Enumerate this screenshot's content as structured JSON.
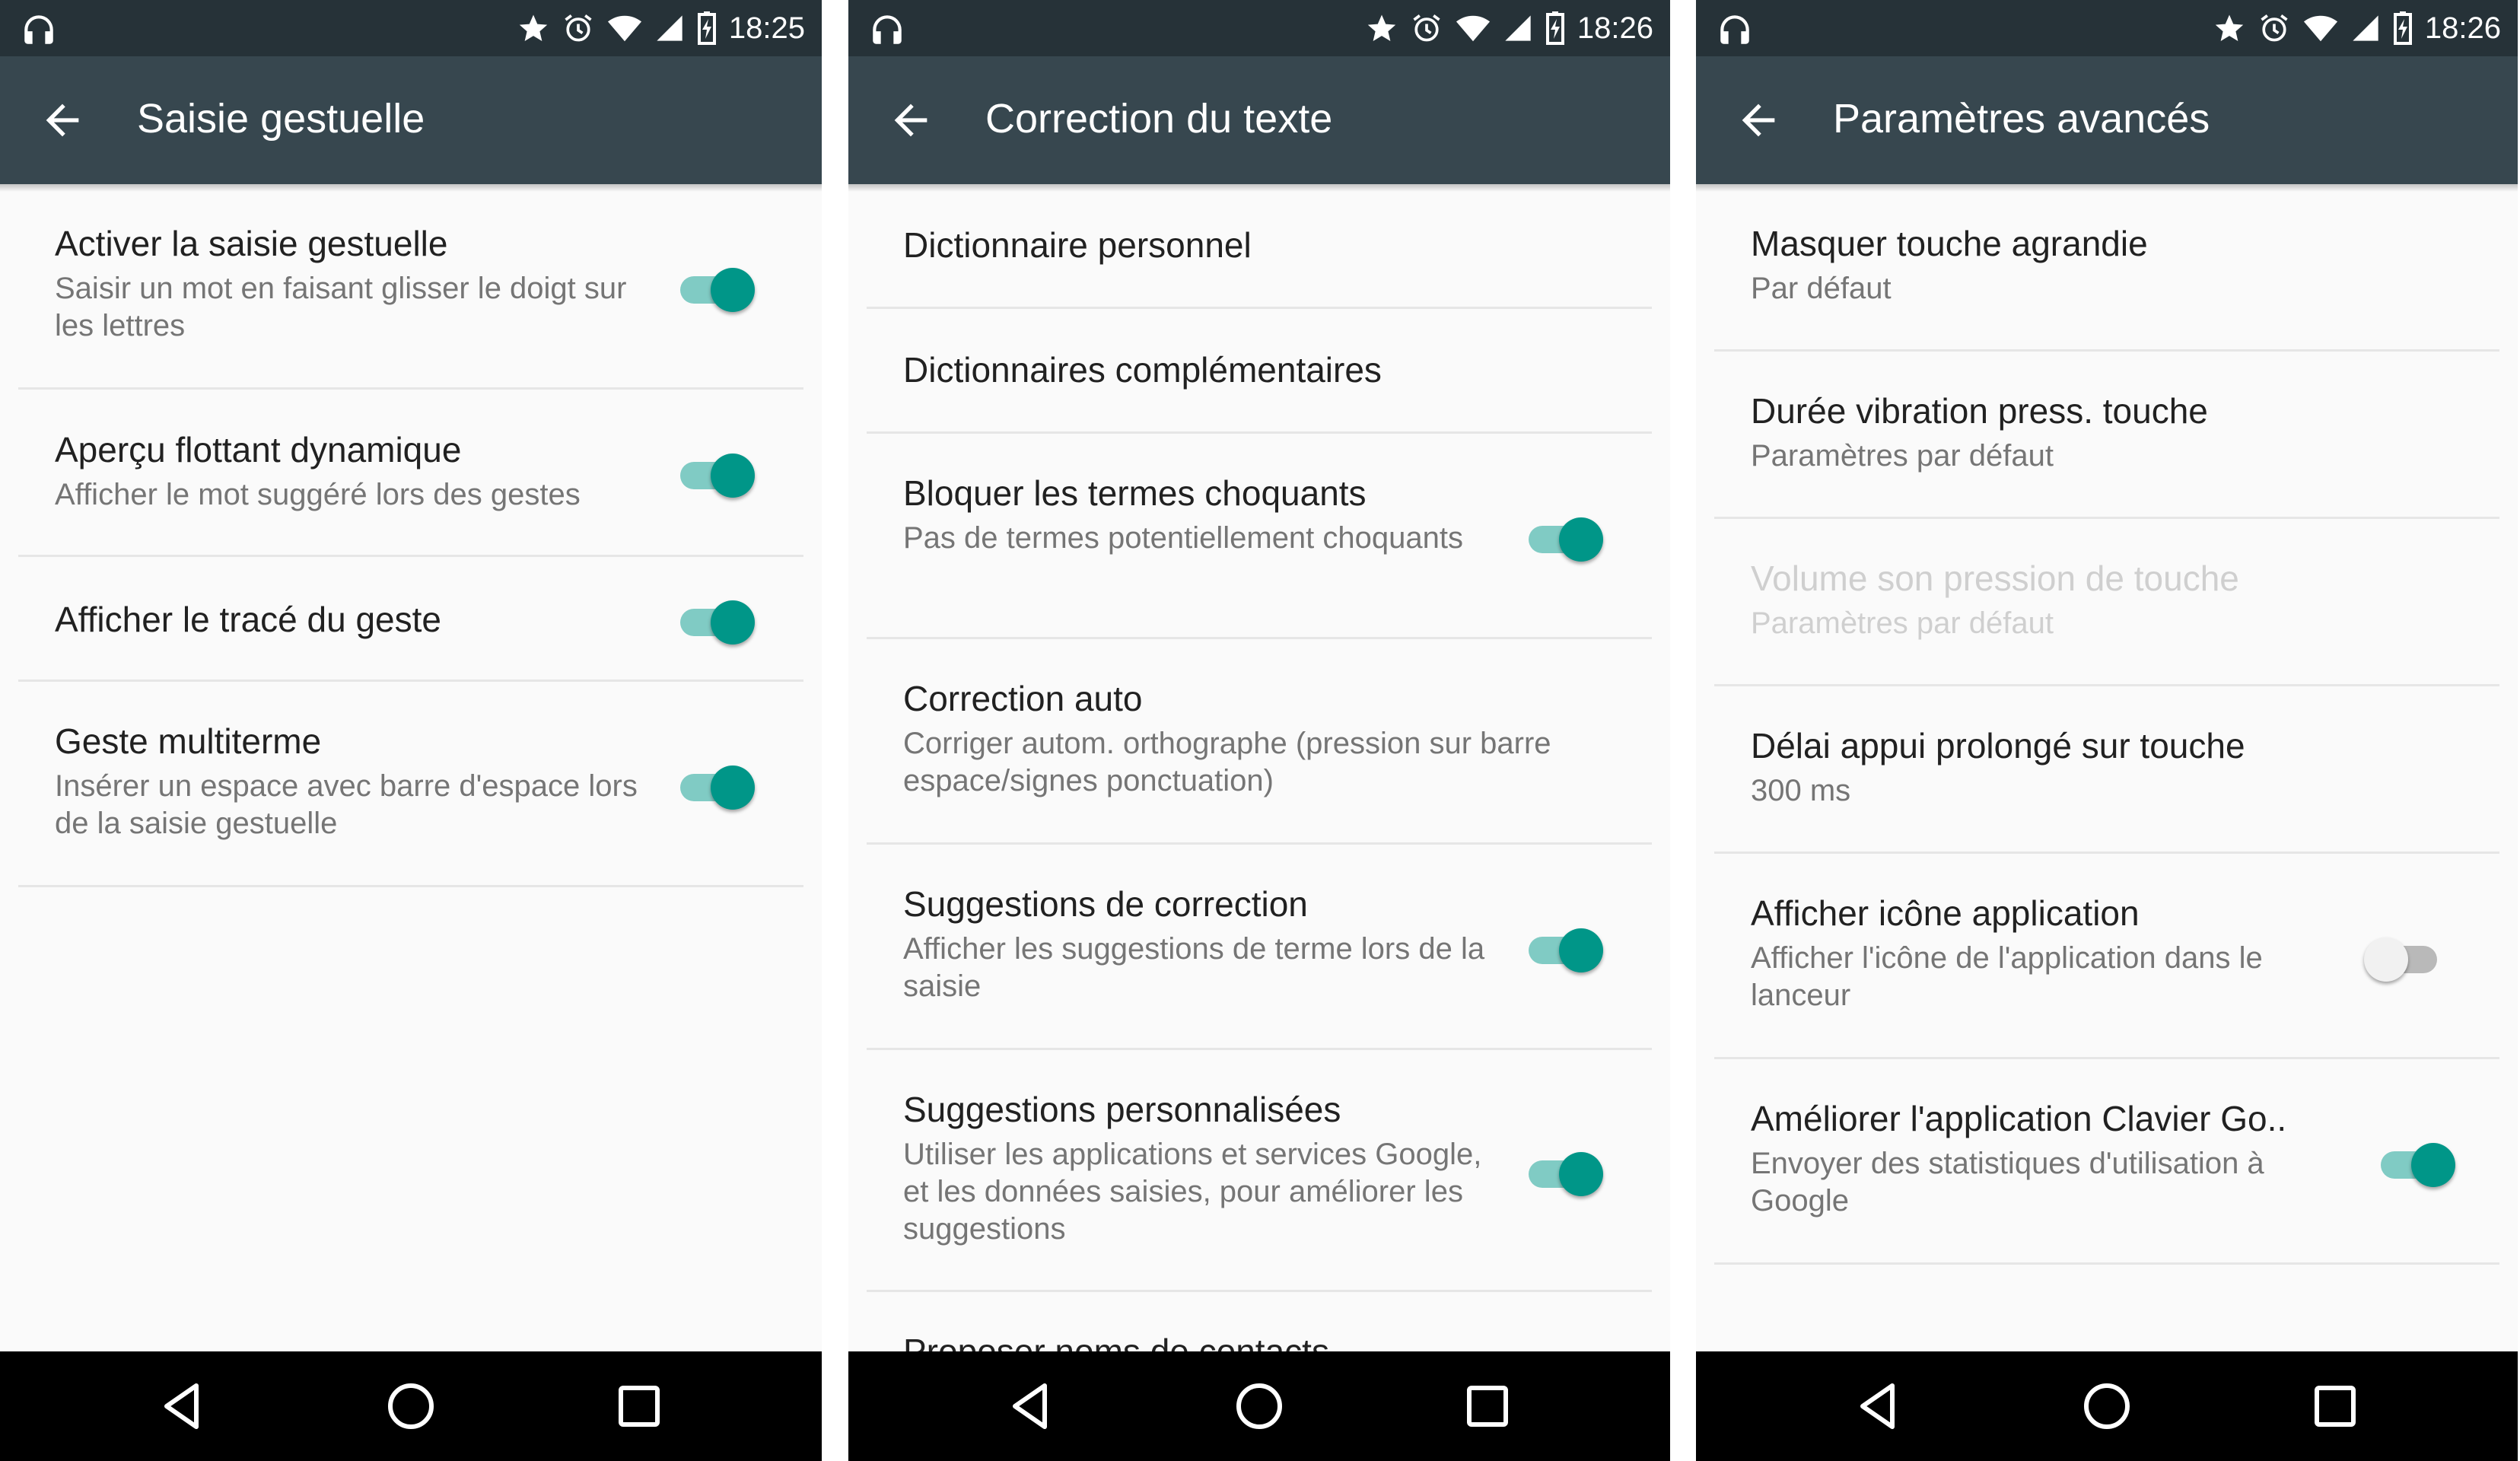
{
  "panels": [
    {
      "status_time": "18:25",
      "title": "Saisie gestuelle",
      "items": [
        {
          "title": "Activer la saisie gestuelle",
          "subtitle": "Saisir un mot en faisant glisser le doigt sur les lettres",
          "switch": true
        },
        {
          "title": "Aperçu flottant dynamique",
          "subtitle": "Afficher le mot suggéré lors des gestes",
          "switch": true
        },
        {
          "title": "Afficher le tracé du geste",
          "subtitle": "",
          "switch": true
        },
        {
          "title": "Geste multiterme",
          "subtitle": "Insérer un espace avec barre d'espace lors de la saisie gestuelle",
          "switch": true
        }
      ]
    },
    {
      "status_time": "18:26",
      "title": "Correction du texte",
      "items": [
        {
          "title": "Dictionnaire personnel",
          "subtitle": ""
        },
        {
          "title": "Dictionnaires complémentaires",
          "subtitle": ""
        },
        {
          "title": "Bloquer les termes choquants",
          "subtitle": "Pas de termes potentiellement choquants",
          "switch": true
        },
        {
          "title": "Correction auto",
          "subtitle": "Corriger autom. orthographe (pression sur barre espace/signes ponctuation)"
        },
        {
          "title": "Suggestions de correction",
          "subtitle": "Afficher les suggestions de terme lors de la saisie",
          "switch": true
        },
        {
          "title": "Suggestions personnalisées",
          "subtitle": "Utiliser les applications et services Google, et les données saisies, pour améliorer les suggestions",
          "switch": true
        },
        {
          "title": "Proposer noms de contacts",
          "subtitle": ""
        }
      ]
    },
    {
      "status_time": "18:26",
      "title": "Paramètres avancés",
      "items": [
        {
          "title": "Masquer touche agrandie",
          "subtitle": "Par défaut"
        },
        {
          "title": "Durée vibration press. touche",
          "subtitle": "Paramètres par défaut"
        },
        {
          "title": "Volume son pression de touche",
          "subtitle": "Paramètres par défaut",
          "disabled": true
        },
        {
          "title": "Délai appui prolongé sur touche",
          "subtitle": "300 ms"
        },
        {
          "title": "Afficher icône application",
          "subtitle": "Afficher l'icône de l'application dans le lanceur",
          "switch": false
        },
        {
          "title": "Améliorer l'application Clavier Go..",
          "subtitle": "Envoyer des statistiques d'utilisation à Google",
          "switch": true
        }
      ]
    }
  ],
  "colors": {
    "statusbar": "#263238",
    "appbar": "#37474f",
    "accent": "#009688",
    "accent_track": "#80cbc4",
    "navbar": "#000000"
  },
  "icons": [
    "headset-icon",
    "star-icon",
    "alarm-icon",
    "wifi-icon",
    "cell-signal-icon",
    "battery-charging-icon",
    "back-arrow-icon",
    "nav-back-icon",
    "nav-home-icon",
    "nav-recent-icon"
  ]
}
